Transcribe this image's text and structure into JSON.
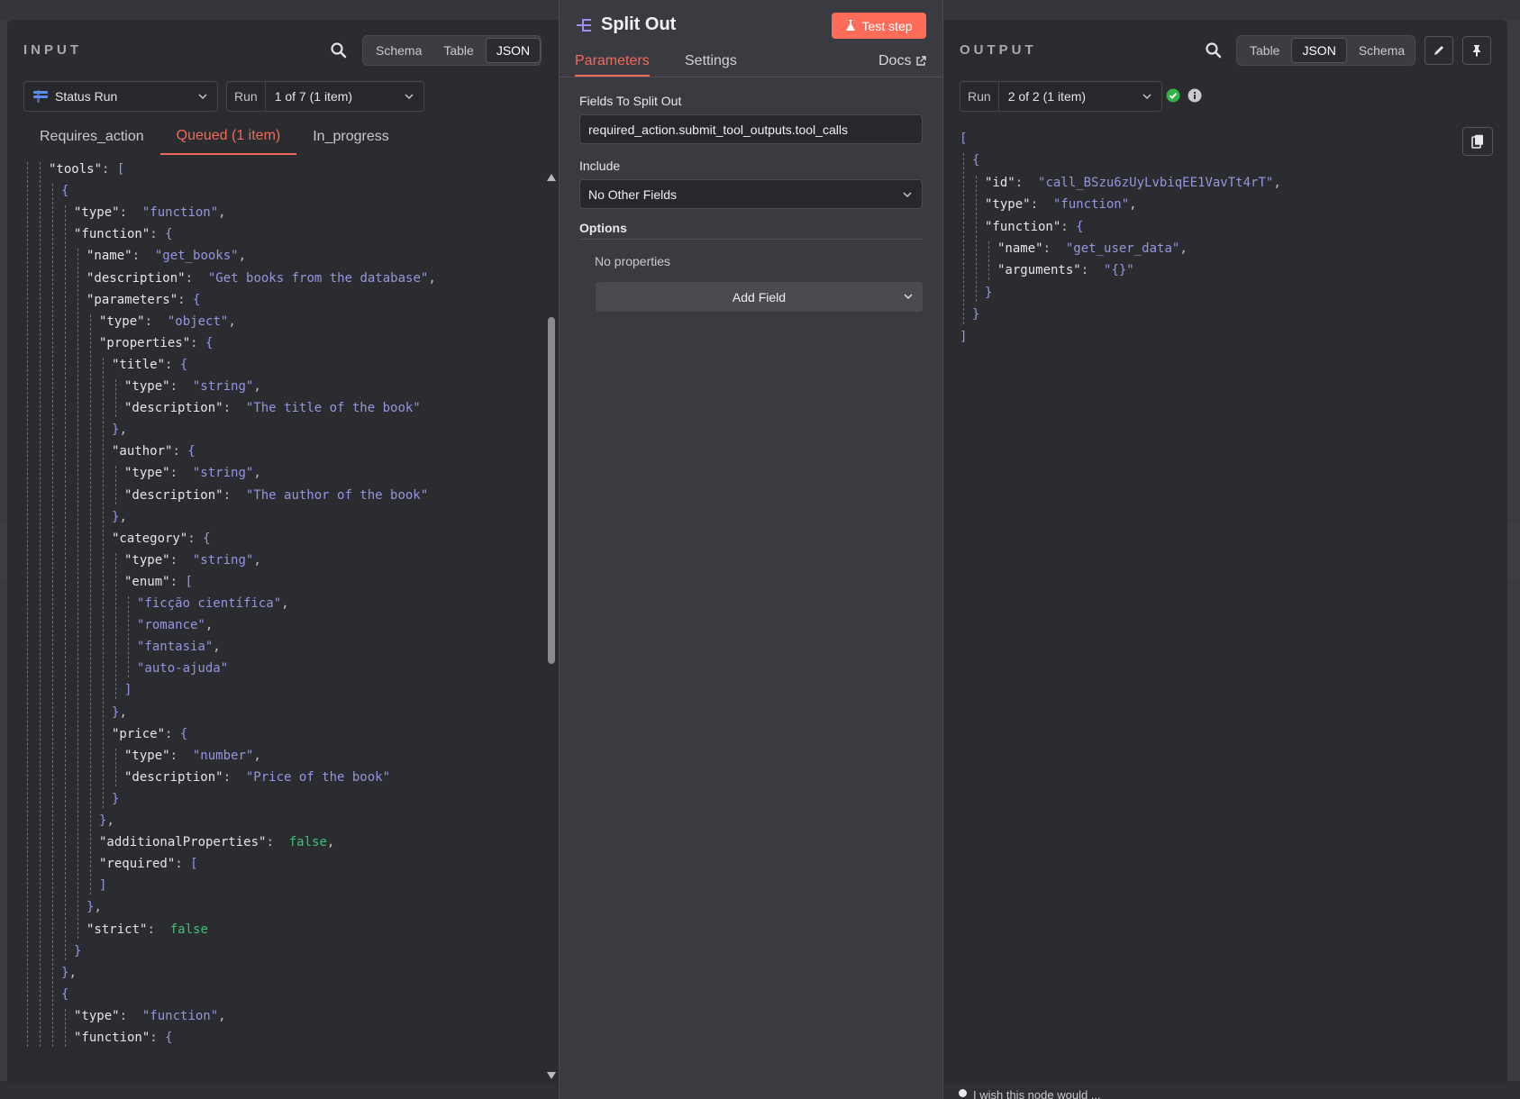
{
  "input": {
    "title": "INPUT",
    "view_tabs": [
      "Schema",
      "Table",
      "JSON"
    ],
    "active_view": "JSON",
    "node_select": "Status Run",
    "run_label": "Run",
    "run_value": "1 of 7 (1 item)",
    "branch_tabs": [
      "Requires_action",
      "Queued (1 item)",
      "In_progress"
    ],
    "active_branch": "Queued (1 item)"
  },
  "node": {
    "title": "Split Out",
    "test_button": "Test step",
    "tabs": [
      "Parameters",
      "Settings"
    ],
    "active_tab": "Parameters",
    "docs_label": "Docs",
    "fields_label": "Fields To Split Out",
    "fields_value": "required_action.submit_tool_outputs.tool_calls",
    "include_label": "Include",
    "include_value": "No Other Fields",
    "options_label": "Options",
    "no_properties": "No properties",
    "add_field": "Add Field"
  },
  "output": {
    "title": "OUTPUT",
    "view_tabs": [
      "Table",
      "JSON",
      "Schema"
    ],
    "active_view": "JSON",
    "run_label": "Run",
    "run_value": "2 of 2 (1 item)"
  },
  "input_json_lines": [
    {
      "d": 2,
      "t": [
        [
          "k",
          "\"tools\""
        ],
        [
          "p",
          ": "
        ],
        [
          "br",
          "["
        ]
      ]
    },
    {
      "d": 3,
      "t": [
        [
          "br",
          "{"
        ]
      ]
    },
    {
      "d": 4,
      "t": [
        [
          "k",
          "\"type\""
        ],
        [
          "p",
          ":  "
        ],
        [
          "s",
          "\"function\""
        ],
        [
          "p",
          ","
        ]
      ]
    },
    {
      "d": 4,
      "t": [
        [
          "k",
          "\"function\""
        ],
        [
          "p",
          ": "
        ],
        [
          "br",
          "{"
        ]
      ]
    },
    {
      "d": 5,
      "t": [
        [
          "k",
          "\"name\""
        ],
        [
          "p",
          ":  "
        ],
        [
          "s",
          "\"get_books\""
        ],
        [
          "p",
          ","
        ]
      ]
    },
    {
      "d": 5,
      "t": [
        [
          "k",
          "\"description\""
        ],
        [
          "p",
          ":  "
        ],
        [
          "s",
          "\"Get books from the database\""
        ],
        [
          "p",
          ","
        ]
      ]
    },
    {
      "d": 5,
      "t": [
        [
          "k",
          "\"parameters\""
        ],
        [
          "p",
          ": "
        ],
        [
          "br",
          "{"
        ]
      ]
    },
    {
      "d": 6,
      "t": [
        [
          "k",
          "\"type\""
        ],
        [
          "p",
          ":  "
        ],
        [
          "s",
          "\"object\""
        ],
        [
          "p",
          ","
        ]
      ]
    },
    {
      "d": 6,
      "t": [
        [
          "k",
          "\"properties\""
        ],
        [
          "p",
          ": "
        ],
        [
          "br",
          "{"
        ]
      ]
    },
    {
      "d": 7,
      "t": [
        [
          "k",
          "\"title\""
        ],
        [
          "p",
          ": "
        ],
        [
          "br",
          "{"
        ]
      ]
    },
    {
      "d": 8,
      "t": [
        [
          "k",
          "\"type\""
        ],
        [
          "p",
          ":  "
        ],
        [
          "s",
          "\"string\""
        ],
        [
          "p",
          ","
        ]
      ]
    },
    {
      "d": 8,
      "t": [
        [
          "k",
          "\"description\""
        ],
        [
          "p",
          ":  "
        ],
        [
          "s",
          "\"The title of the book\""
        ]
      ]
    },
    {
      "d": 7,
      "t": [
        [
          "br",
          "}"
        ],
        [
          "p",
          ","
        ]
      ]
    },
    {
      "d": 7,
      "t": [
        [
          "k",
          "\"author\""
        ],
        [
          "p",
          ": "
        ],
        [
          "br",
          "{"
        ]
      ]
    },
    {
      "d": 8,
      "t": [
        [
          "k",
          "\"type\""
        ],
        [
          "p",
          ":  "
        ],
        [
          "s",
          "\"string\""
        ],
        [
          "p",
          ","
        ]
      ]
    },
    {
      "d": 8,
      "t": [
        [
          "k",
          "\"description\""
        ],
        [
          "p",
          ":  "
        ],
        [
          "s",
          "\"The author of the book\""
        ]
      ]
    },
    {
      "d": 7,
      "t": [
        [
          "br",
          "}"
        ],
        [
          "p",
          ","
        ]
      ]
    },
    {
      "d": 7,
      "t": [
        [
          "k",
          "\"category\""
        ],
        [
          "p",
          ": "
        ],
        [
          "br",
          "{"
        ]
      ]
    },
    {
      "d": 8,
      "t": [
        [
          "k",
          "\"type\""
        ],
        [
          "p",
          ":  "
        ],
        [
          "s",
          "\"string\""
        ],
        [
          "p",
          ","
        ]
      ]
    },
    {
      "d": 8,
      "t": [
        [
          "k",
          "\"enum\""
        ],
        [
          "p",
          ": "
        ],
        [
          "br",
          "["
        ]
      ]
    },
    {
      "d": 9,
      "t": [
        [
          "s",
          "\"ficção científica\""
        ],
        [
          "p",
          ","
        ]
      ]
    },
    {
      "d": 9,
      "t": [
        [
          "s",
          "\"romance\""
        ],
        [
          "p",
          ","
        ]
      ]
    },
    {
      "d": 9,
      "t": [
        [
          "s",
          "\"fantasia\""
        ],
        [
          "p",
          ","
        ]
      ]
    },
    {
      "d": 9,
      "t": [
        [
          "s",
          "\"auto-ajuda\""
        ]
      ]
    },
    {
      "d": 8,
      "t": [
        [
          "br",
          "]"
        ]
      ]
    },
    {
      "d": 7,
      "t": [
        [
          "br",
          "}"
        ],
        [
          "p",
          ","
        ]
      ]
    },
    {
      "d": 7,
      "t": [
        [
          "k",
          "\"price\""
        ],
        [
          "p",
          ": "
        ],
        [
          "br",
          "{"
        ]
      ]
    },
    {
      "d": 8,
      "t": [
        [
          "k",
          "\"type\""
        ],
        [
          "p",
          ":  "
        ],
        [
          "s",
          "\"number\""
        ],
        [
          "p",
          ","
        ]
      ]
    },
    {
      "d": 8,
      "t": [
        [
          "k",
          "\"description\""
        ],
        [
          "p",
          ":  "
        ],
        [
          "s",
          "\"Price of the book\""
        ]
      ]
    },
    {
      "d": 7,
      "t": [
        [
          "br",
          "}"
        ]
      ]
    },
    {
      "d": 6,
      "t": [
        [
          "br",
          "}"
        ],
        [
          "p",
          ","
        ]
      ]
    },
    {
      "d": 6,
      "t": [
        [
          "k",
          "\"additionalProperties\""
        ],
        [
          "p",
          ":  "
        ],
        [
          "b",
          "false"
        ],
        [
          "p",
          ","
        ]
      ]
    },
    {
      "d": 6,
      "t": [
        [
          "k",
          "\"required\""
        ],
        [
          "p",
          ": "
        ],
        [
          "br",
          "["
        ]
      ]
    },
    {
      "d": 6,
      "t": [
        [
          "br",
          "]"
        ]
      ]
    },
    {
      "d": 5,
      "t": [
        [
          "br",
          "}"
        ],
        [
          "p",
          ","
        ]
      ]
    },
    {
      "d": 5,
      "t": [
        [
          "k",
          "\"strict\""
        ],
        [
          "p",
          ":  "
        ],
        [
          "b",
          "false"
        ]
      ]
    },
    {
      "d": 4,
      "t": [
        [
          "br",
          "}"
        ]
      ]
    },
    {
      "d": 3,
      "t": [
        [
          "br",
          "}"
        ],
        [
          "p",
          ","
        ]
      ]
    },
    {
      "d": 3,
      "t": [
        [
          "br",
          "{"
        ]
      ]
    },
    {
      "d": 4,
      "t": [
        [
          "k",
          "\"type\""
        ],
        [
          "p",
          ":  "
        ],
        [
          "s",
          "\"function\""
        ],
        [
          "p",
          ","
        ]
      ]
    },
    {
      "d": 4,
      "t": [
        [
          "k",
          "\"function\""
        ],
        [
          "p",
          ": "
        ],
        [
          "br",
          "{"
        ]
      ]
    }
  ],
  "output_json_lines": [
    {
      "d": 0,
      "t": [
        [
          "br",
          "["
        ]
      ]
    },
    {
      "d": 1,
      "t": [
        [
          "br",
          "{"
        ]
      ]
    },
    {
      "d": 2,
      "t": [
        [
          "k",
          "\"id\""
        ],
        [
          "p",
          ":  "
        ],
        [
          "s",
          "\"call_BSzu6zUyLvbiqEE1VavTt4rT\""
        ],
        [
          "p",
          ","
        ]
      ]
    },
    {
      "d": 2,
      "t": [
        [
          "k",
          "\"type\""
        ],
        [
          "p",
          ":  "
        ],
        [
          "s",
          "\"function\""
        ],
        [
          "p",
          ","
        ]
      ]
    },
    {
      "d": 2,
      "t": [
        [
          "k",
          "\"function\""
        ],
        [
          "p",
          ": "
        ],
        [
          "br",
          "{"
        ]
      ]
    },
    {
      "d": 3,
      "t": [
        [
          "k",
          "\"name\""
        ],
        [
          "p",
          ":  "
        ],
        [
          "s",
          "\"get_user_data\""
        ],
        [
          "p",
          ","
        ]
      ]
    },
    {
      "d": 3,
      "t": [
        [
          "k",
          "\"arguments\""
        ],
        [
          "p",
          ":  "
        ],
        [
          "s",
          "\"{}\""
        ]
      ]
    },
    {
      "d": 2,
      "t": [
        [
          "br",
          "}"
        ]
      ]
    },
    {
      "d": 1,
      "t": [
        [
          "br",
          "}"
        ]
      ]
    },
    {
      "d": 0,
      "t": [
        [
          "br",
          "]"
        ]
      ]
    }
  ],
  "footer_hint": "I wish this node would ...",
  "colors": {
    "accent": "#ff6d5a",
    "success": "#2fb344",
    "string": "#9a93df",
    "boolean": "#3fc07a"
  }
}
